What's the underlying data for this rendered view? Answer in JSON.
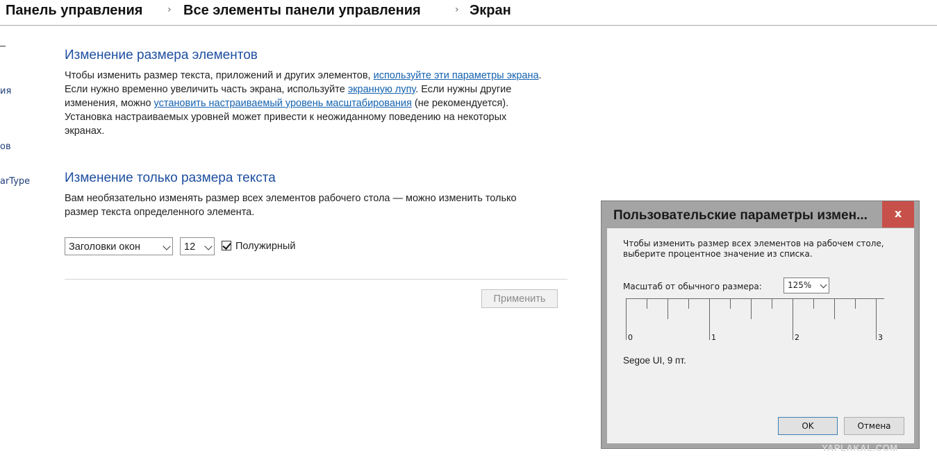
{
  "breadcrumb": {
    "items": [
      "Панель управления",
      "Все элементы панели управления",
      "Экран"
    ],
    "separator": "›"
  },
  "sidebar": {
    "fragments": [
      "ия",
      "ов",
      "arType"
    ]
  },
  "section_size": {
    "title": "Изменение размера элементов",
    "text1": "Чтобы изменить размер текста, приложений и других элементов, ",
    "link1": "используйте эти параметры экрана",
    "text2": ".",
    "text3": "Если нужно временно увеличить часть экрана, используйте ",
    "link2": "экранную лупу",
    "text4": ". Если нужны другие",
    "text5": "изменения, можно ",
    "link3": "установить настраиваемый уровень масштабирования",
    "text6": " (не рекомендуется).",
    "text7": "Установка настраиваемых уровней может привести к неожиданному поведению на некоторых",
    "text8": "экранах."
  },
  "section_text": {
    "title": "Изменение только размера текста",
    "line1": "Вам необязательно изменять размер всех элементов рабочего стола — можно изменить только",
    "line2": "размер текста определенного элемента.",
    "element_select": "Заголовки окон",
    "size_select": "12",
    "bold_label": "Полужирный",
    "bold_checked": true,
    "apply_label": "Применить"
  },
  "dialog": {
    "title": "Пользовательские параметры измен...",
    "close_label": "x",
    "instruction_line1": "Чтобы изменить размер всех элементов на рабочем столе,",
    "instruction_line2": "выберите процентное значение из списка.",
    "scale_label": "Масштаб от обычного размера:",
    "scale_value": "125%",
    "ruler_labels": [
      "0",
      "1",
      "2",
      "3"
    ],
    "font_sample": "Segoe UI, 9 пт.",
    "ok_label": "OK",
    "cancel_label": "Отмена"
  },
  "watermark": "YAPLAKAL.COM",
  "colors": {
    "heading": "#1e4fa0",
    "link": "#1462b0",
    "close_button": "#c7514a",
    "dialog_frame": "#a4a4a4"
  }
}
